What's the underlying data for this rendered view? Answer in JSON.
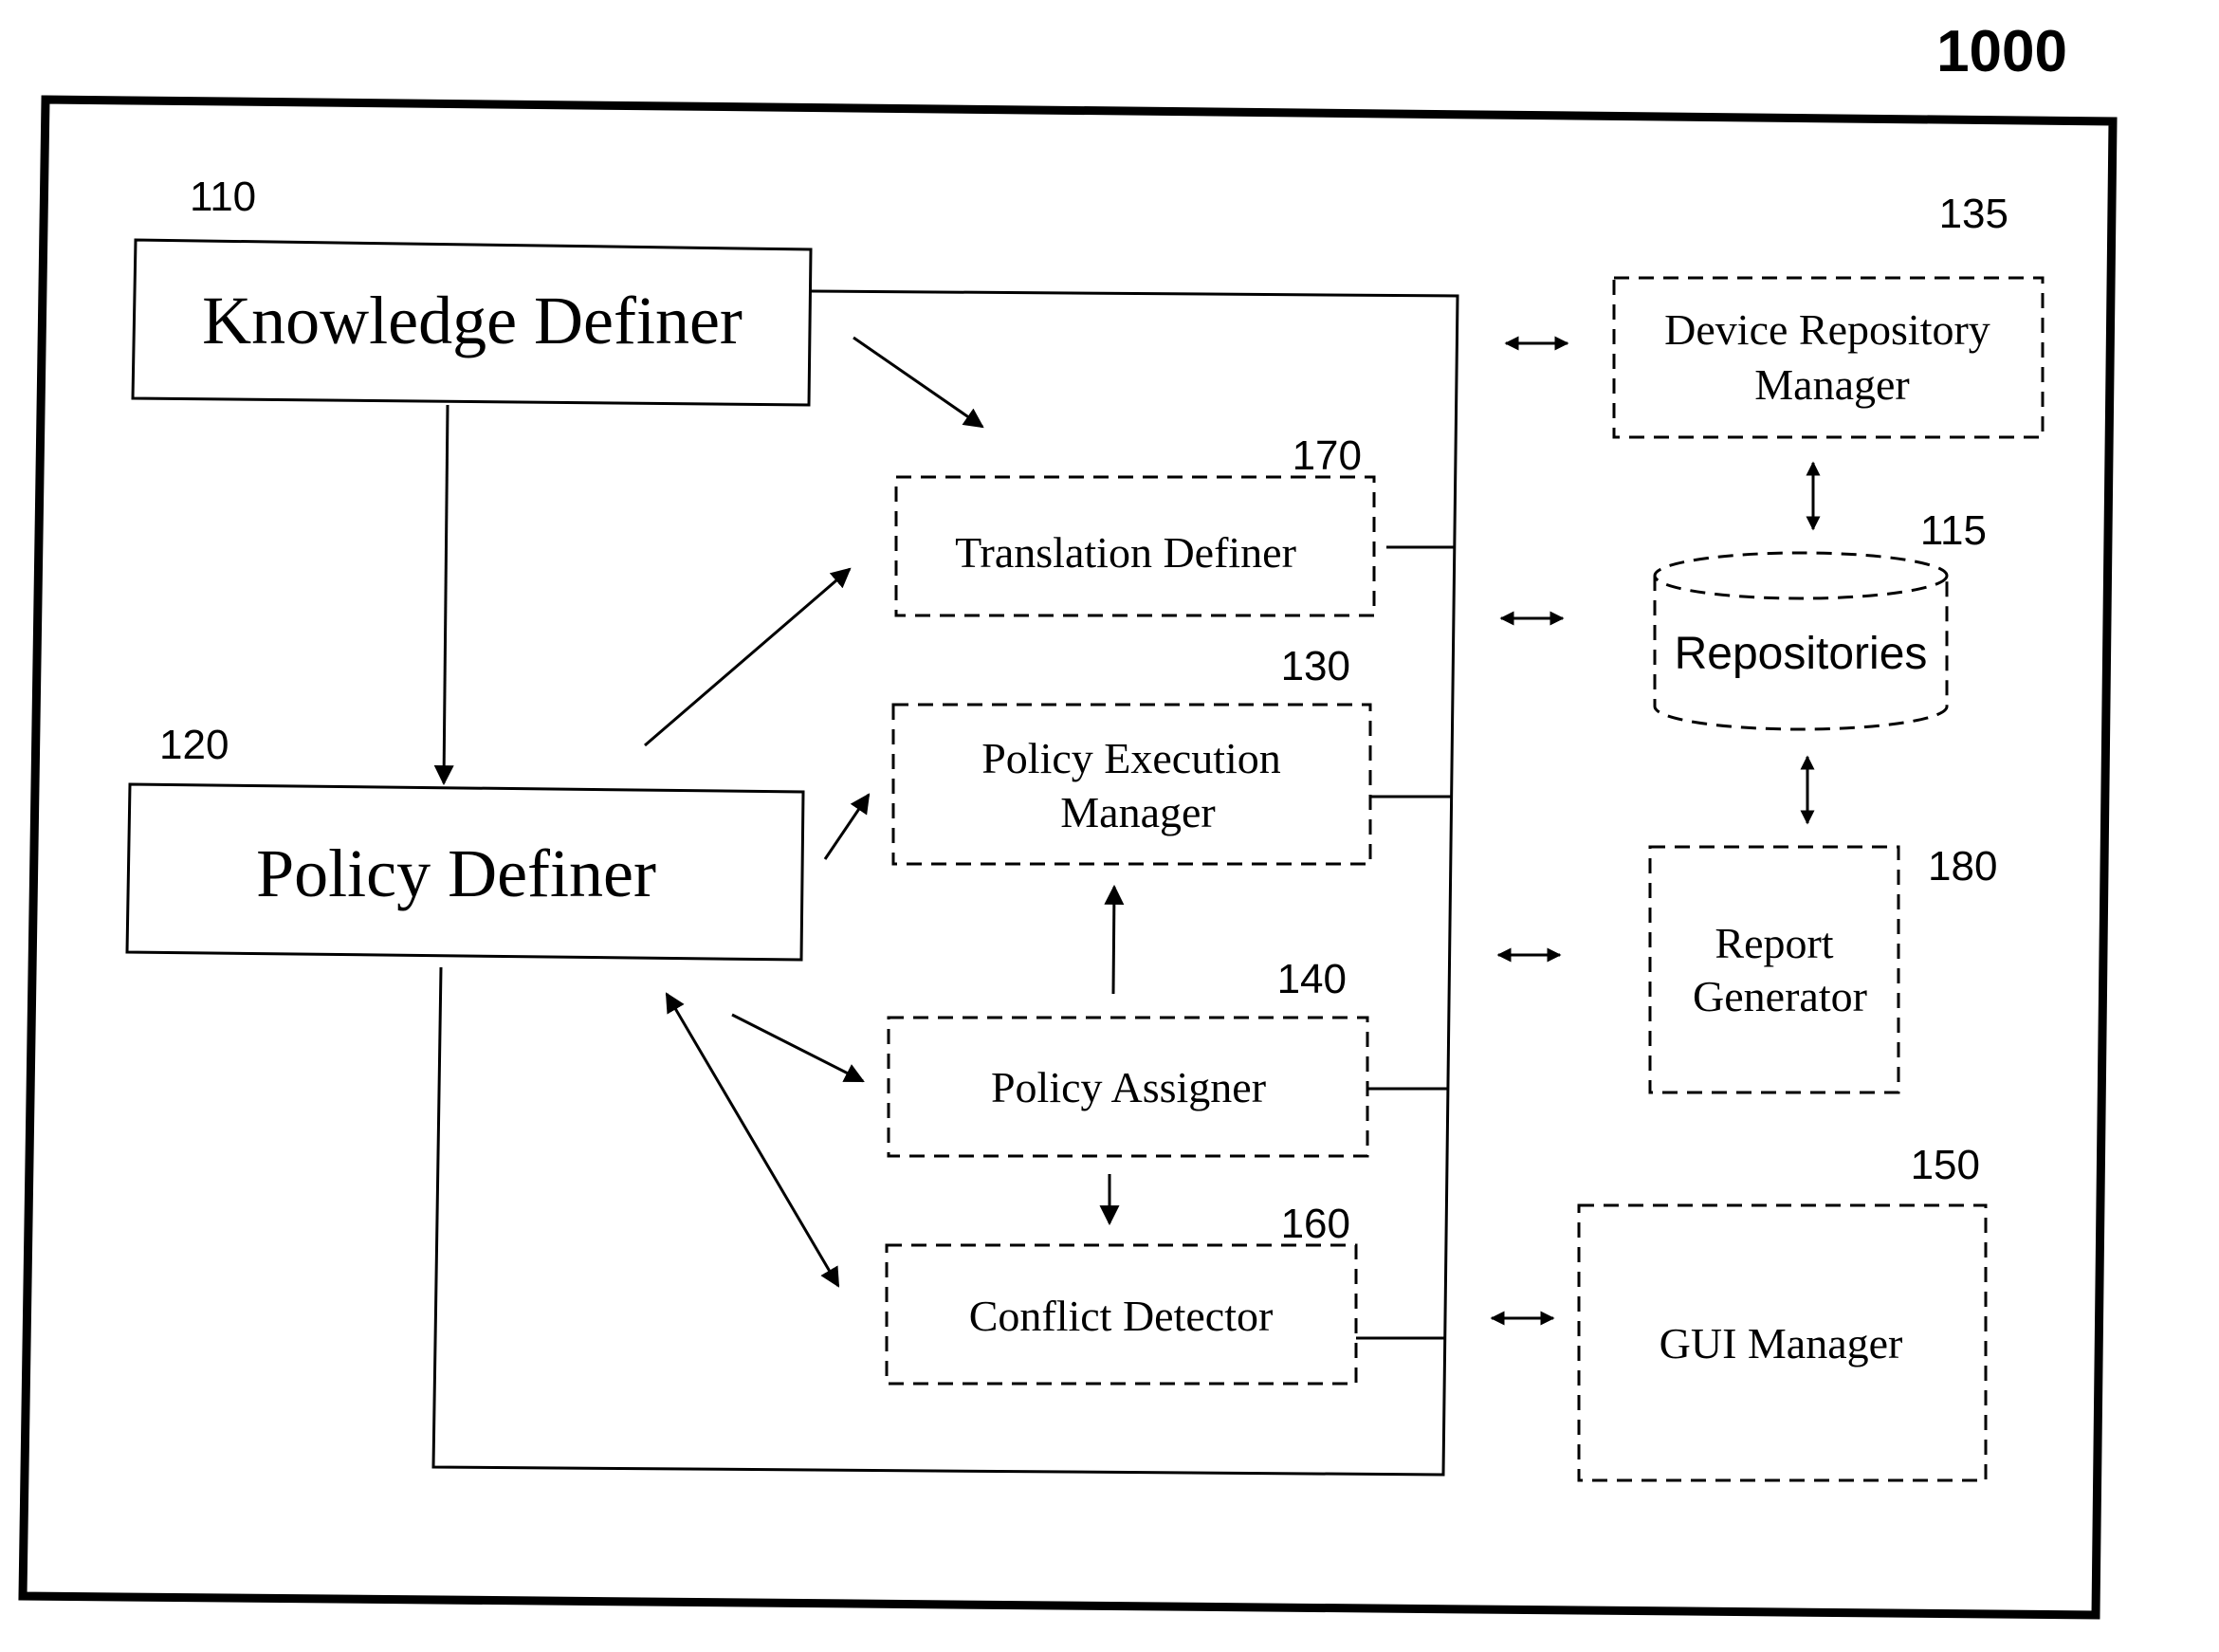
{
  "figure": {
    "number": "1000",
    "colors": {
      "ink": "#000000",
      "background": "#ffffff"
    }
  },
  "components": {
    "knowledge_definer": {
      "ref": "110",
      "label": "Knowledge Definer",
      "style": "solid"
    },
    "policy_definer": {
      "ref": "120",
      "label": "Policy Definer",
      "style": "solid"
    },
    "translation_definer": {
      "ref": "170",
      "label": "Translation Definer",
      "style": "dashed"
    },
    "policy_execution_manager": {
      "ref": "130",
      "label_line1": "Policy Execution",
      "label_line2": "Manager",
      "style": "dashed"
    },
    "policy_assigner": {
      "ref": "140",
      "label": "Policy Assigner",
      "style": "dashed"
    },
    "conflict_detector": {
      "ref": "160",
      "label": "Conflict Detector",
      "style": "dashed"
    },
    "device_repository_manager": {
      "ref": "135",
      "label_line1": "Device Repository",
      "label_line2": "Manager",
      "style": "dashed"
    },
    "repositories": {
      "ref": "115",
      "label": "Repositories",
      "style": "dashed-cylinder"
    },
    "report_generator": {
      "ref": "180",
      "label_line1": "Report",
      "label_line2": "Generator",
      "style": "dashed"
    },
    "gui_manager": {
      "ref": "150",
      "label": "GUI Manager",
      "style": "dashed"
    }
  },
  "connections": [
    {
      "from": "Knowledge Definer",
      "to": "Policy Definer",
      "type": "arrow"
    },
    {
      "from": "Knowledge Definer",
      "to": "Translation Definer",
      "type": "arrow"
    },
    {
      "from": "Policy Definer",
      "to": "Translation Definer",
      "type": "arrow"
    },
    {
      "from": "Policy Definer",
      "to": "Policy Execution Manager",
      "type": "arrow"
    },
    {
      "from": "Policy Definer",
      "to": "Policy Assigner",
      "type": "arrow"
    },
    {
      "from": "Policy Definer",
      "to": "Conflict Detector",
      "type": "bidirectional"
    },
    {
      "from": "Policy Assigner",
      "to": "Policy Execution Manager",
      "type": "arrow"
    },
    {
      "from": "Policy Assigner",
      "to": "Conflict Detector",
      "type": "arrow"
    },
    {
      "from": "Bus",
      "to": "Device Repository Manager",
      "type": "bidirectional"
    },
    {
      "from": "Bus",
      "to": "Repositories",
      "type": "bidirectional"
    },
    {
      "from": "Bus",
      "to": "Report Generator",
      "type": "bidirectional"
    },
    {
      "from": "Bus",
      "to": "GUI Manager",
      "type": "bidirectional"
    },
    {
      "from": "Device Repository Manager",
      "to": "Repositories",
      "type": "bidirectional"
    },
    {
      "from": "Repositories",
      "to": "Report Generator",
      "type": "bidirectional"
    }
  ]
}
